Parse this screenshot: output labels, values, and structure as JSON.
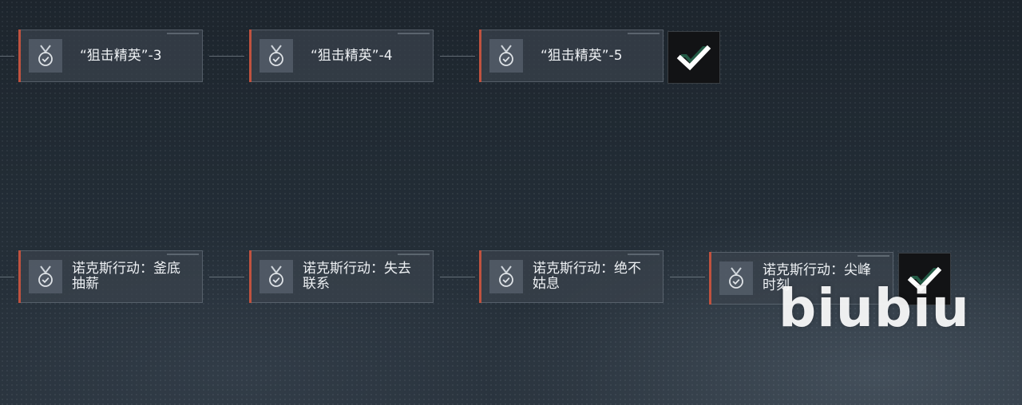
{
  "row1": {
    "nodes": [
      {
        "label": "“狙击精英”-3",
        "icon": "medal-check-icon"
      },
      {
        "label": "“狙击精英”-4",
        "icon": "medal-check-icon"
      },
      {
        "label": "“狙击精英”-5",
        "icon": "medal-check-icon"
      }
    ],
    "completion_icon": "checkmark-icon"
  },
  "row2": {
    "nodes": [
      {
        "label": "诺克斯行动：釜底\n抽薪",
        "icon": "medal-check-icon"
      },
      {
        "label": "诺克斯行动：失去\n联系",
        "icon": "medal-check-icon"
      },
      {
        "label": "诺克斯行动：绝不\n姑息",
        "icon": "medal-check-icon"
      },
      {
        "label": "诺克斯行动：尖峰\n时刻",
        "icon": "medal-check-icon"
      }
    ],
    "completion_icon": "checkmark-icon"
  },
  "watermark": "biubiu",
  "colors": {
    "accent": "#c0523f",
    "node_bg": "#3a424c",
    "complete_bg": "#121315",
    "check": "#ffffff"
  }
}
